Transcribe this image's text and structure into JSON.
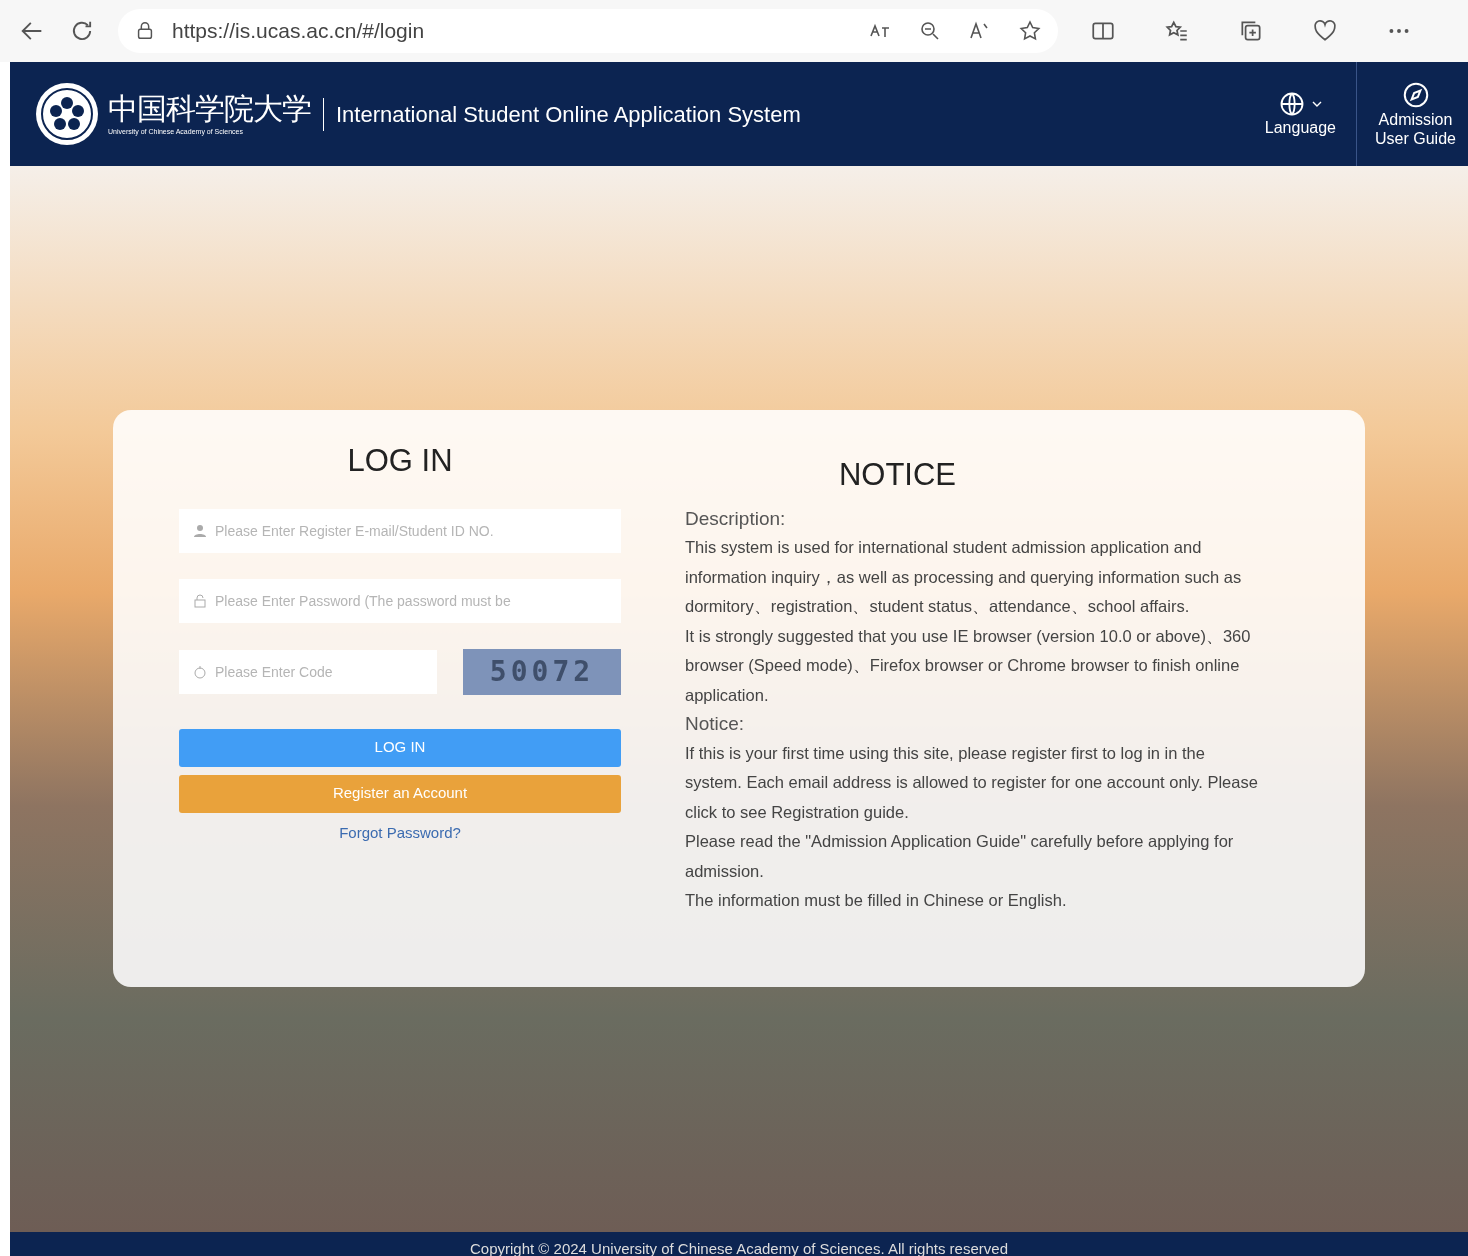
{
  "browser": {
    "url": "https://is.ucas.ac.cn/#/login"
  },
  "header": {
    "logo_chinese": "中国科学院大学",
    "logo_english": "University of Chinese Academy of Sciences",
    "title": "International Student Online Application System",
    "language": "Language",
    "guide": "Admission User Guide"
  },
  "login": {
    "title": "LOG IN",
    "email_placeholder": "Please Enter Register E-mail/Student ID NO.",
    "password_placeholder": "Please Enter Password (The password must be",
    "code_placeholder": "Please Enter Code",
    "captcha": "50072",
    "login_button": "LOG IN",
    "register_button": "Register an Account",
    "forgot_link": "Forgot Password?"
  },
  "notice": {
    "title": "NOTICE",
    "sections": [
      {
        "heading": "Description:",
        "paragraphs": [
          {
            "text": "This system is used for international student admission application and information inquiry，as well as processing and querying information such as dormitory、registration、student status、attendance、school affairs."
          },
          {
            "text": "It is strongly suggested that you use IE browser (version 10.0 or above)、360 browser (Speed mode)、Firefox browser or Chrome browser to finish online application."
          }
        ]
      },
      {
        "heading": "Notice:",
        "paragraphs": [
          {
            "text": "If this is your first time using this site, please register first to log in in the system. Each email address is allowed to register for one account only. Please click to see Registration guide."
          },
          {
            "text": "Please read the ",
            "link": "\"Admission Application Guide\"",
            "after": " carefully before applying for admission."
          },
          {
            "text": "The information must be filled in Chinese or English."
          }
        ]
      }
    ]
  },
  "footer": "Copyright © 2024 University of Chinese Academy of Sciences. All rights reserved"
}
